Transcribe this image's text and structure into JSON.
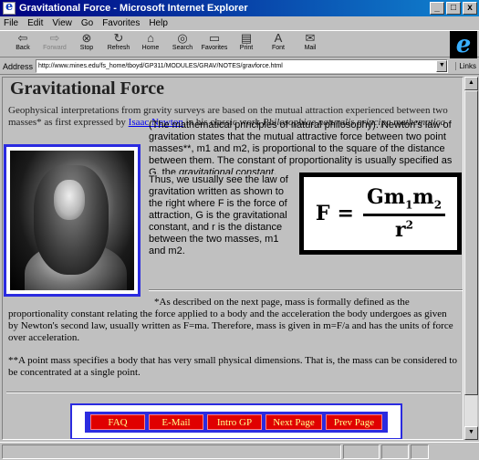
{
  "window": {
    "title": "Gravitational Force - Microsoft Internet Explorer",
    "minimize": "_",
    "maximize": "□",
    "close": "x"
  },
  "menu": [
    "File",
    "Edit",
    "View",
    "Go",
    "Favorites",
    "Help"
  ],
  "toolbar": [
    {
      "label": "Back",
      "icon": "back-arrow-icon",
      "glyph": "⇦",
      "enabled": true
    },
    {
      "label": "Forward",
      "icon": "forward-arrow-icon",
      "glyph": "⇨",
      "enabled": false
    },
    {
      "label": "Stop",
      "icon": "stop-icon",
      "glyph": "⊗",
      "enabled": true
    },
    {
      "label": "Refresh",
      "icon": "refresh-icon",
      "glyph": "↻",
      "enabled": true
    },
    {
      "label": "Home",
      "icon": "home-icon",
      "glyph": "⌂",
      "enabled": true
    },
    {
      "label": "Search",
      "icon": "search-icon",
      "glyph": "◎",
      "enabled": true
    },
    {
      "label": "Favorites",
      "icon": "favorites-icon",
      "glyph": "▭",
      "enabled": true
    },
    {
      "label": "Print",
      "icon": "print-icon",
      "glyph": "▤",
      "enabled": true
    },
    {
      "label": "Font",
      "icon": "font-icon",
      "glyph": "A",
      "enabled": true
    },
    {
      "label": "Mail",
      "icon": "mail-icon",
      "glyph": "✉",
      "enabled": true
    }
  ],
  "address": {
    "label": "Address",
    "url": "http://www.mines.edu/fs_home/tboyd/GP311/MODULES/GRAV/NOTES/gravforce.html",
    "links": "Links"
  },
  "content": {
    "heading": "Gravitational Force",
    "intro_1": "Geophysical interpretations from gravity surveys are based on the mutual attraction experienced between two masses* as first expressed by ",
    "newton_link": "Isaac Newton",
    "intro_2": " in his classic work ",
    "work_title": "Philosophiae naturalis principa mathematica",
    "intro_3": " (The mathematical principles of natural philosophy). Newton's law of gravitation states that the mutual attractive force between two point masses**, m1 and m2, is proportional to the square of the distance between them. The constant of proportionality is usually specified as G, the ",
    "grav_const": "gravitational constant",
    "wrap_text": "Thus, we usually see the law of gravitation written as shown to the right where F is the force of attraction, G is the gravitational constant, and r is the distance between the two masses, m1 and m2.",
    "formula": {
      "lhs": "F",
      "eq": "=",
      "G": "G",
      "m": "m",
      "sub1": "1",
      "sub2": "2",
      "r": "r",
      "sup": "2"
    },
    "footnote_1": "*As described on the next page, mass is formally defined as the proportionality constant relating the force applied to a body and the acceleration the body undergoes as given by Newton's second law, usually written as F=ma. Therefore, mass is given in m=F/a and has the units of force over acceleration.",
    "footnote_2": "**A point mass specifies a body that has very small physical dimensions. That is, the mass can be considered to be concentrated at a single point."
  },
  "nav": [
    "FAQ",
    "E-Mail",
    "Intro GP",
    "Next Page",
    "Prev Page"
  ],
  "colors": {
    "nav_button": "#e00000",
    "nav_text": "#ffff90",
    "frame": "#2b2be0"
  },
  "status": {
    "text": "",
    "zone": ""
  }
}
